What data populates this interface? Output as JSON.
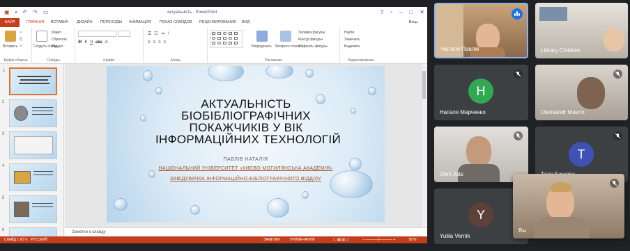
{
  "ppt": {
    "doc_title": "актуальність - PowerPoint",
    "login": "Вход",
    "tabs": [
      "ФАЙЛ",
      "ГЛАВНАЯ",
      "ВСТАВКА",
      "ДИЗАЙН",
      "ПЕРЕХОДЫ",
      "АНИМАЦИЯ",
      "ПОКАЗ СЛАЙДОВ",
      "РЕЦЕНЗИРОВАНИЕ",
      "ВИД"
    ],
    "active_tab": "ГЛАВНАЯ",
    "ribbon": {
      "paste": "Вставить",
      "cut": "Вырезать",
      "copy": "Копировать",
      "format": "Формат",
      "new_slide": "Создать слайд",
      "layout": "Макет",
      "reset": "Сбросить",
      "section": "Раздел",
      "arrange": "Упорядочить",
      "quick_styles": "Экспресс-стили",
      "shape_fill": "Заливка фигуры",
      "shape_outline": "Контур фигуры",
      "shape_effects": "Эффекты фигуры",
      "find": "Найти",
      "replace": "Заменить",
      "select": "Выделить",
      "groups": {
        "clipboard": "Буфер обмена",
        "slides": "Слайды",
        "font": "Шрифт",
        "paragraph": "Абзац",
        "drawing": "Рисование",
        "editing": "Редактирование"
      }
    },
    "thumbs": [
      "1",
      "2",
      "3",
      "4",
      "5",
      "6"
    ],
    "slide": {
      "title_lines": [
        "АКТУАЛЬНІСТЬ",
        "БІОБІБЛІОГРАФІЧНИХ",
        "ПОКАЖЧИКІВ У ВІК",
        "ІНФОРМАЦІЙНИХ ТЕХНОЛОГІЙ"
      ],
      "author": "ПАВЛІВ НАТАЛІЯ",
      "affiliation": "НАЦІОНАЛЬНИЙ УНІВЕРСИТЕТ «КИЄВО-МОГИЛЯНСЬКА АКАДЕМІЯ»",
      "position": "ЗАВІДУВАЧКА ІНФОРМАЦІЙНО-БІБЛІОГРАФІЧНОГО ВІДДІЛУ"
    },
    "notes_placeholder": "Заметки к слайду",
    "status": {
      "slide_info": "СЛАЙД 1 ИЗ 6",
      "language": "РУССКИЙ",
      "notes": "ЗАМЕТКИ",
      "comments": "ПРИМЕЧАНИЯ",
      "zoom": "78 %"
    }
  },
  "participants": [
    {
      "name": "Наталя Павлів",
      "kind": "video",
      "speaking": true
    },
    {
      "name": "Library Children",
      "kind": "video",
      "muted": false
    },
    {
      "name": "Наталя Марченко",
      "kind": "avatar",
      "initial": "Н",
      "color": "#33a853",
      "muted": true
    },
    {
      "name": "Oleksandr Mavrin",
      "kind": "video",
      "muted": true
    },
    {
      "name": "Oleh Jats",
      "kind": "video",
      "muted": true
    },
    {
      "name": "Таня Бишова",
      "kind": "avatar",
      "initial": "T",
      "color": "#3f51b5",
      "muted": true
    },
    {
      "name": "Yuliia Vernik",
      "kind": "avatar",
      "initial": "Y",
      "color": "#5d4037",
      "muted": true
    },
    {
      "name": "Вы",
      "kind": "video",
      "muted": true
    }
  ]
}
